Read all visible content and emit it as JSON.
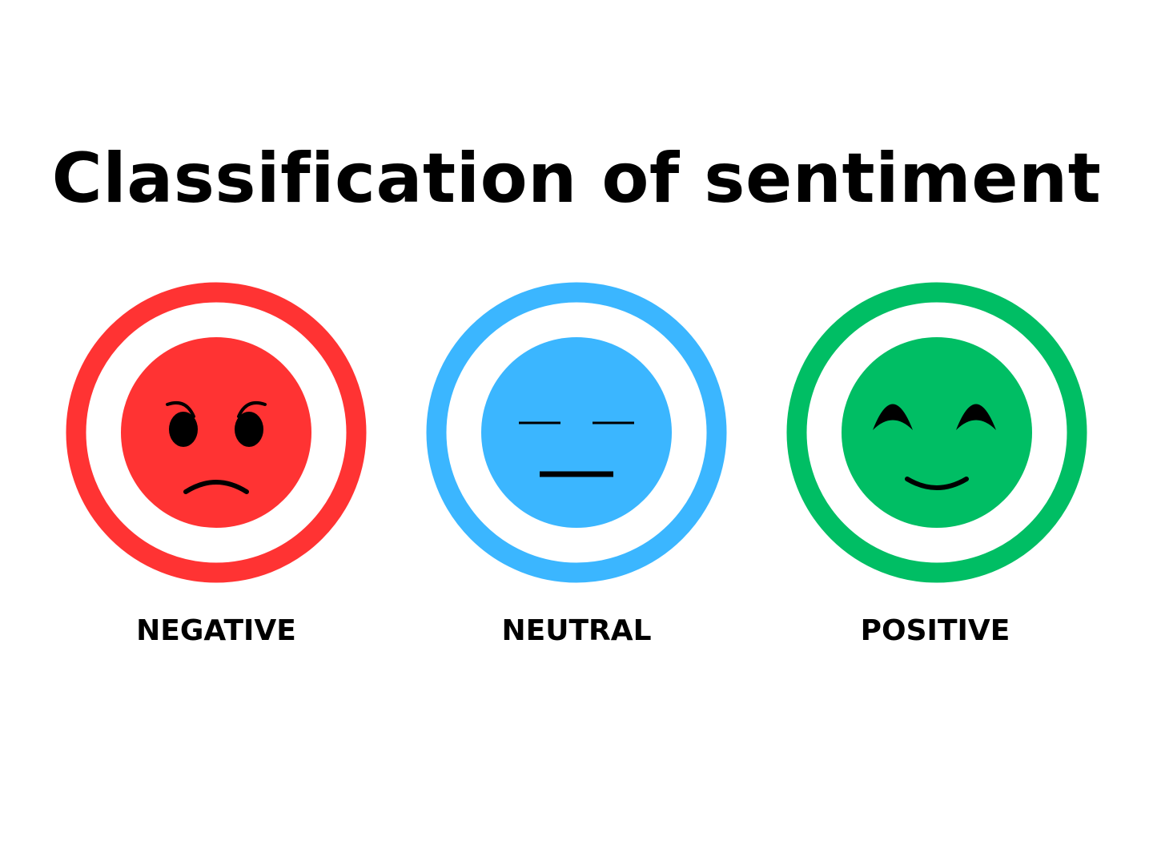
{
  "title": "Classification of sentiment",
  "sentiments": [
    {
      "label": "NEGATIVE",
      "color": "#ff3333",
      "icon": "angry-face-icon"
    },
    {
      "label": "NEUTRAL",
      "color": "#3bb6ff",
      "icon": "neutral-face-icon"
    },
    {
      "label": "POSITIVE",
      "color": "#00be64",
      "icon": "smiling-face-icon"
    }
  ]
}
